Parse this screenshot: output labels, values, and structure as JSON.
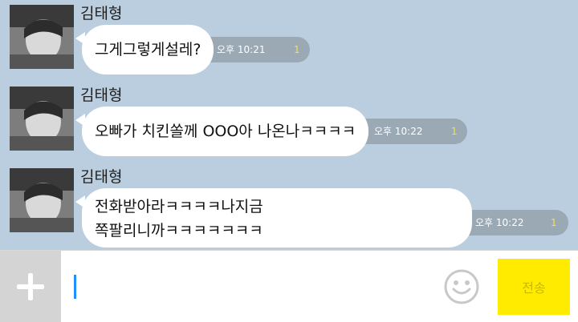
{
  "messages": [
    {
      "sender": "김태형",
      "lines": [
        "그게그렇게설레?"
      ],
      "time": "오후 10:21",
      "unread": "1"
    },
    {
      "sender": "김태형",
      "lines": [
        "오빠가 치킨쏠께 OOO아 나온나ㅋㅋㅋㅋ"
      ],
      "time": "오후 10:22",
      "unread": "1"
    },
    {
      "sender": "김태형",
      "lines": [
        "전화받아라ㅋㅋㅋㅋ나지금",
        "쪽팔리니까ㅋㅋㅋㅋㅋㅋㅋ"
      ],
      "time": "오후 10:22",
      "unread": "1"
    }
  ],
  "input": {
    "value": "",
    "placeholder": ""
  },
  "send_label": "전송",
  "icons": {
    "add": "plus-icon",
    "emoji": "emoticon-icon"
  },
  "colors": {
    "background": "#bacee0",
    "bubble": "#ffffff",
    "send_button": "#ffeb00",
    "unread": "#f5e04a"
  }
}
